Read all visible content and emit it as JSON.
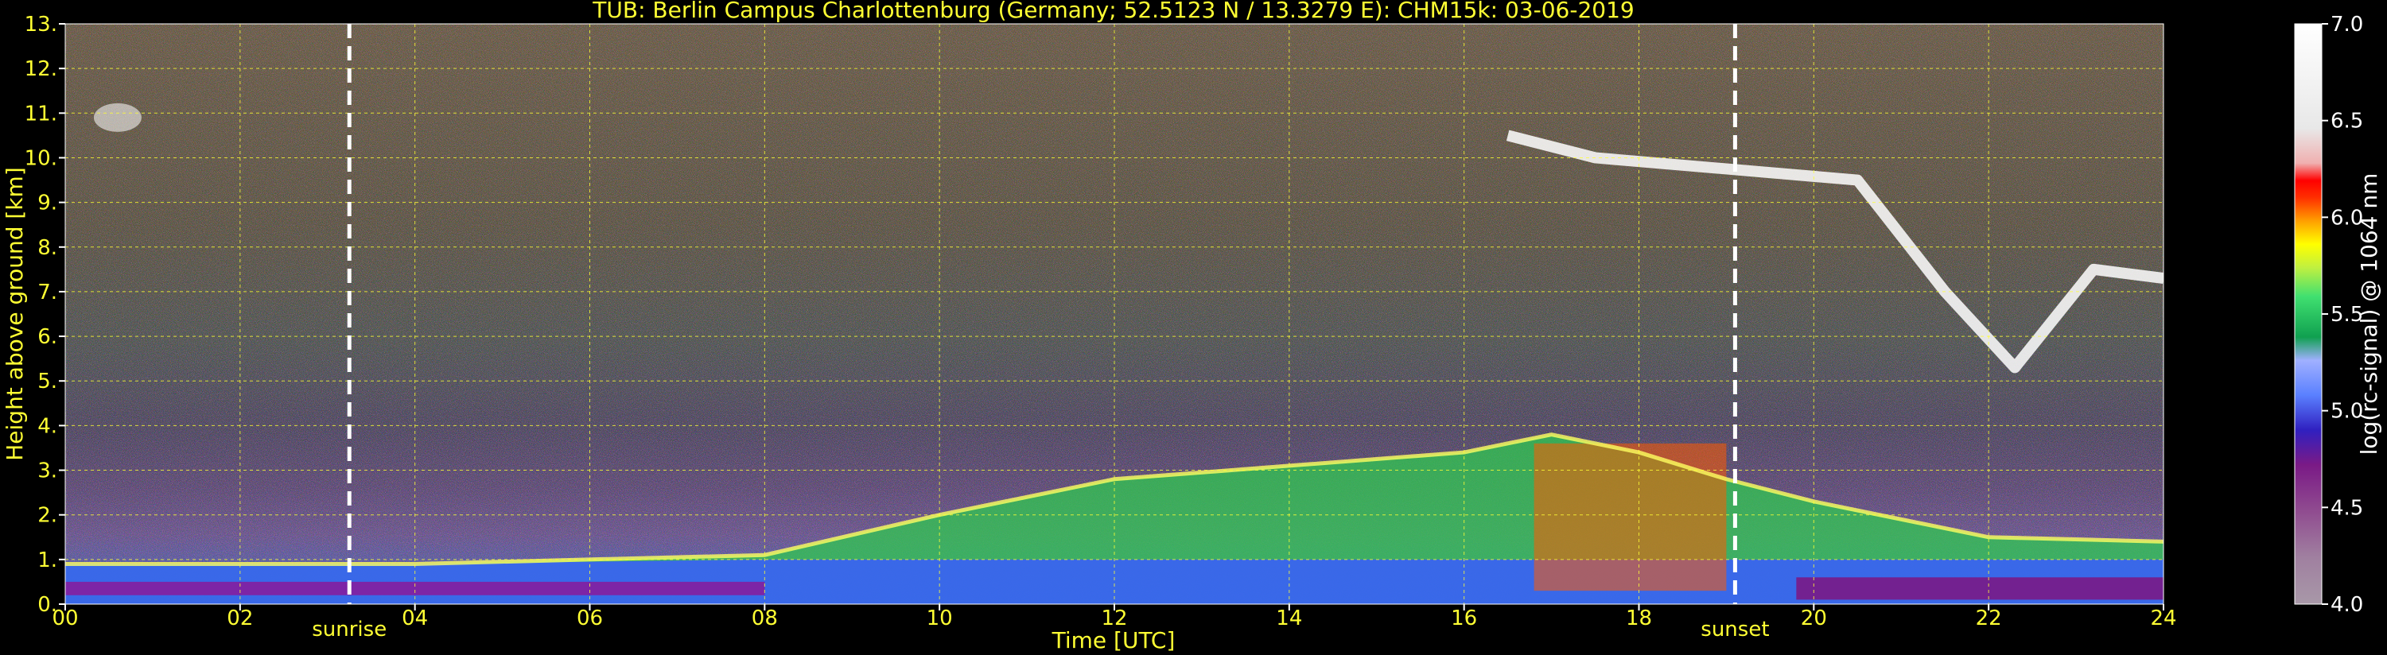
{
  "chart_data": {
    "type": "heatmap",
    "title": "TUB: Berlin Campus Charlottenburg (Germany; 52.5123 N / 13.3279 E):    CHM15k: 03-06-2019",
    "xlabel": "Time [UTC]",
    "ylabel": "Height above ground [km]",
    "xlim": [
      0,
      24
    ],
    "ylim": [
      0,
      13
    ],
    "x_ticks": [
      "00",
      "02",
      "04",
      "06",
      "08",
      "10",
      "12",
      "14",
      "16",
      "18",
      "20",
      "22",
      "24"
    ],
    "y_ticks": [
      "0.",
      "1.",
      "2.",
      "3.",
      "4.",
      "5.",
      "6.",
      "7.",
      "8.",
      "9.",
      "10.",
      "11.",
      "12.",
      "13."
    ],
    "grid": true,
    "markers": [
      {
        "label": "sunrise",
        "time": 3.25
      },
      {
        "label": "sunset",
        "time": 19.1
      }
    ],
    "colorbar": {
      "label": "log(rc-signal) @ 1064 nm",
      "range": [
        4.0,
        7.0
      ],
      "ticks": [
        "4.0",
        "4.5",
        "5.0",
        "5.5",
        "6.0",
        "6.5",
        "7.0"
      ]
    },
    "features": {
      "boundary_layer_top_km": [
        {
          "time": 0,
          "height": 0.9
        },
        {
          "time": 4,
          "height": 0.9
        },
        {
          "time": 8,
          "height": 1.1
        },
        {
          "time": 10,
          "height": 2.0
        },
        {
          "time": 12,
          "height": 2.8
        },
        {
          "time": 14,
          "height": 3.1
        },
        {
          "time": 16,
          "height": 3.4
        },
        {
          "time": 17,
          "height": 3.8
        },
        {
          "time": 18,
          "height": 3.4
        },
        {
          "time": 19,
          "height": 2.8
        },
        {
          "time": 20,
          "height": 2.3
        },
        {
          "time": 22,
          "height": 1.5
        },
        {
          "time": 24,
          "height": 1.4
        }
      ],
      "high_cloud_km": [
        {
          "time": 16.5,
          "height": 10.5
        },
        {
          "time": 17.5,
          "height": 10.0
        },
        {
          "time": 20.5,
          "height": 9.5
        },
        {
          "time": 21.5,
          "height": 7.0
        },
        {
          "time": 22.3,
          "height": 5.3
        },
        {
          "time": 23.2,
          "height": 7.5
        },
        {
          "time": 24,
          "height": 7.3
        }
      ]
    }
  }
}
